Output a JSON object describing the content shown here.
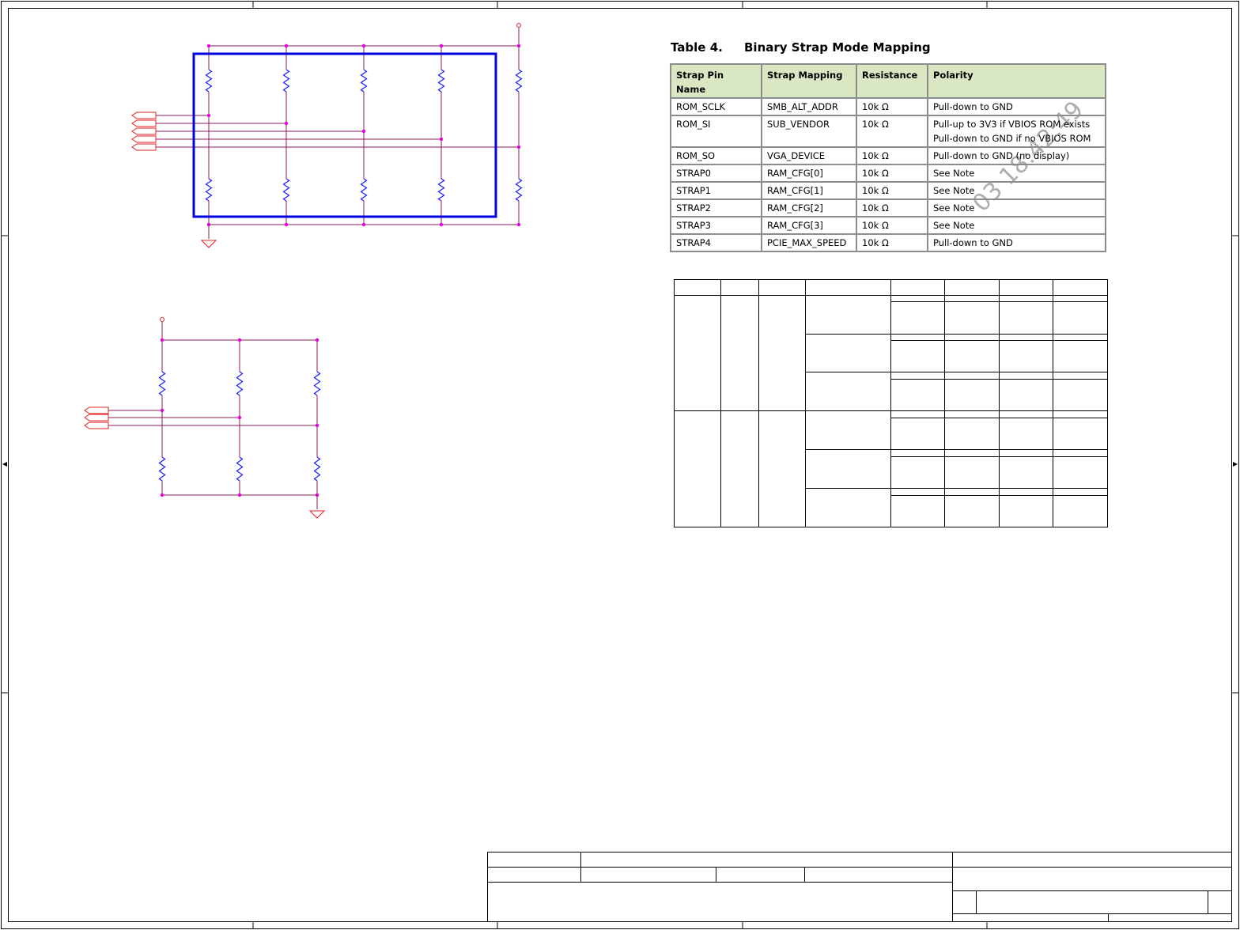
{
  "strap_table": {
    "caption_number": "Table 4.",
    "caption_title": "Binary Strap Mode Mapping",
    "headers": [
      "Strap Pin Name",
      "Strap Mapping",
      "Resistance",
      "Polarity"
    ],
    "rows": [
      {
        "pin": "ROM_SCLK",
        "mapping": "SMB_ALT_ADDR",
        "resistance": "10k Ω",
        "polarity": [
          "Pull-down to GND"
        ]
      },
      {
        "pin": "ROM_SI",
        "mapping": "SUB_VENDOR",
        "resistance": "10k Ω",
        "polarity": [
          "Pull-up to 3V3 if VBIOS ROM exists",
          "Pull-down to GND if no VBIOS ROM"
        ]
      },
      {
        "pin": "ROM_SO",
        "mapping": "VGA_DEVICE",
        "resistance": "10k Ω",
        "polarity": [
          "Pull-down to GND (no display)"
        ]
      },
      {
        "pin": "STRAP0",
        "mapping": "RAM_CFG[0]",
        "resistance": "10k Ω",
        "polarity": [
          "See Note"
        ]
      },
      {
        "pin": "STRAP1",
        "mapping": "RAM_CFG[1]",
        "resistance": "10k Ω",
        "polarity": [
          "See Note"
        ]
      },
      {
        "pin": "STRAP2",
        "mapping": "RAM_CFG[2]",
        "resistance": "10k Ω",
        "polarity": [
          "See Note"
        ]
      },
      {
        "pin": "STRAP3",
        "mapping": "RAM_CFG[3]",
        "resistance": "10k Ω",
        "polarity": [
          "See Note"
        ]
      },
      {
        "pin": "STRAP4",
        "mapping": "PCIE_MAX_SPEED",
        "resistance": "10k Ω",
        "polarity": [
          "Pull-down to GND"
        ]
      }
    ]
  },
  "watermark": "03 18:42:49",
  "colors": {
    "wire": "#8b1a5a",
    "junction": "#e600e6",
    "resistor": "#1a1aff",
    "port": "#e02020",
    "selection_box": "#0000dd",
    "frame": "#000000",
    "header_fill": "#d9e8c2"
  },
  "schematic": {
    "upper_network": {
      "pullup_count": 5,
      "pulldown_count": 5,
      "port_count": 5
    },
    "lower_network": {
      "pullup_count": 3,
      "pulldown_count": 3,
      "port_count": 3
    }
  }
}
